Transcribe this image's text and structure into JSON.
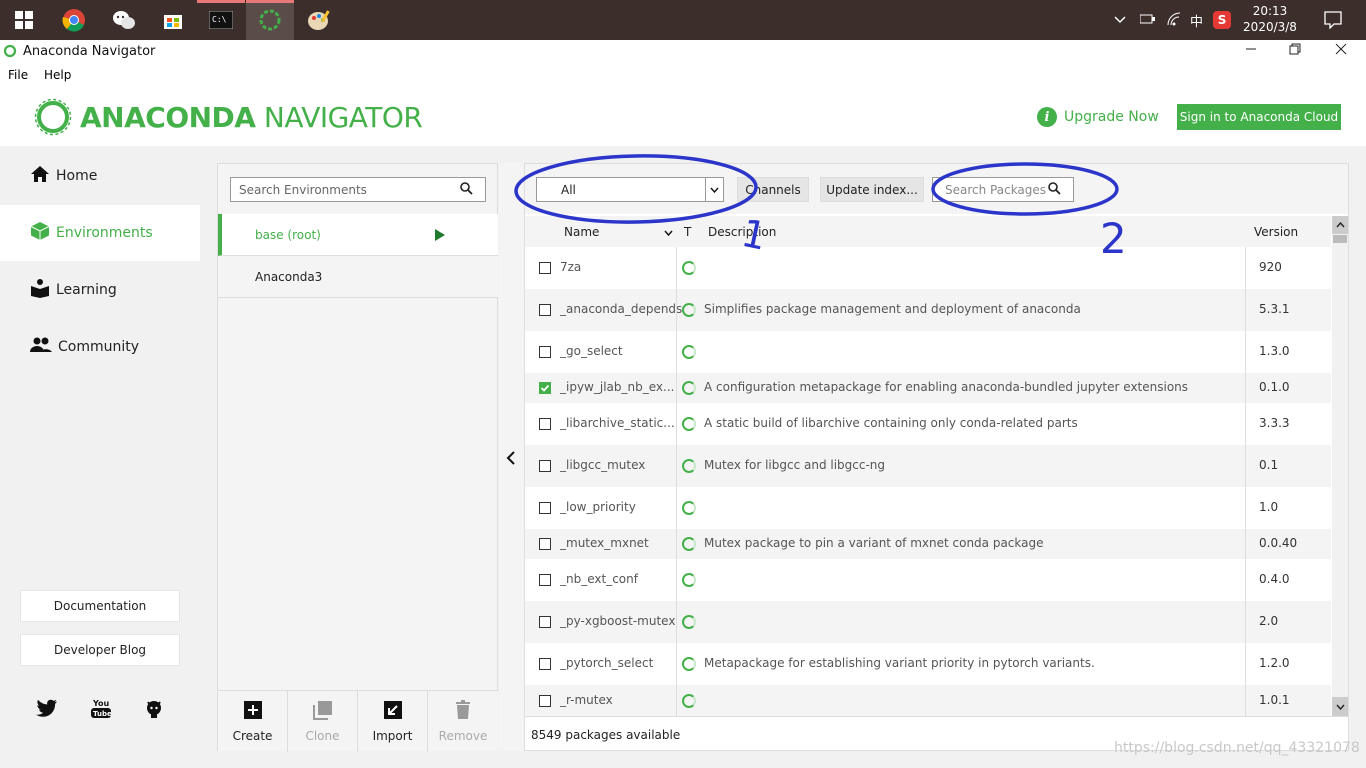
{
  "taskbar": {
    "clock_time": "20:13",
    "clock_date": "2020/3/8",
    "ime": "中"
  },
  "window": {
    "title": "Anaconda Navigator"
  },
  "menu": {
    "file": "File",
    "help": "Help"
  },
  "header": {
    "logo_anaconda": "ANACONDA",
    "logo_navigator": "NAVIGATOR",
    "upgrade_label": "Upgrade Now",
    "signin_label": "Sign in to Anaconda Cloud"
  },
  "sidebar": {
    "items": [
      {
        "label": "Home"
      },
      {
        "label": "Environments"
      },
      {
        "label": "Learning"
      },
      {
        "label": "Community"
      }
    ],
    "documentation": "Documentation",
    "developer_blog": "Developer Blog"
  },
  "environments": {
    "search_placeholder": "Search Environments",
    "list": [
      {
        "name": "base (root)"
      },
      {
        "name": "Anaconda3"
      }
    ],
    "actions": {
      "create": "Create",
      "clone": "Clone",
      "import": "Import",
      "remove": "Remove"
    }
  },
  "packages": {
    "filter_value": "All",
    "channels_label": "Channels",
    "update_index_label": "Update index...",
    "search_placeholder": "Search Packages",
    "columns": {
      "name": "Name",
      "type": "T",
      "description": "Description",
      "version": "Version"
    },
    "rows": [
      {
        "name": "7za",
        "description": "",
        "version": "920",
        "checked": false
      },
      {
        "name": "_anaconda_depends",
        "description": "Simplifies package management and deployment of anaconda",
        "version": "5.3.1",
        "checked": false
      },
      {
        "name": "_go_select",
        "description": "",
        "version": "1.3.0",
        "checked": false
      },
      {
        "name": "_ipyw_jlab_nb_ex...",
        "description": "A configuration metapackage for enabling anaconda-bundled jupyter extensions",
        "version": "0.1.0",
        "checked": true
      },
      {
        "name": "_libarchive_static...",
        "description": "A static build of libarchive containing only conda-related parts",
        "version": "3.3.3",
        "checked": false
      },
      {
        "name": "_libgcc_mutex",
        "description": "Mutex for libgcc and libgcc-ng",
        "version": "0.1",
        "checked": false
      },
      {
        "name": "_low_priority",
        "description": "",
        "version": "1.0",
        "checked": false
      },
      {
        "name": "_mutex_mxnet",
        "description": "Mutex package to pin a variant of mxnet conda package",
        "version": "0.0.40",
        "checked": false
      },
      {
        "name": "_nb_ext_conf",
        "description": "",
        "version": "0.4.0",
        "checked": false
      },
      {
        "name": "_py-xgboost-mutex",
        "description": "",
        "version": "2.0",
        "checked": false
      },
      {
        "name": "_pytorch_select",
        "description": "Metapackage for establishing variant priority in pytorch variants.",
        "version": "1.2.0",
        "checked": false
      },
      {
        "name": "_r-mutex",
        "description": "",
        "version": "1.0.1",
        "checked": false
      }
    ],
    "footer": "8549 packages available"
  },
  "annotations": {
    "mark_1": "1",
    "mark_2": "2"
  },
  "watermark": "https://blog.csdn.net/qq_43321078",
  "colors": {
    "accent_green": "#43b049",
    "annotation_blue": "#2b35c9"
  }
}
